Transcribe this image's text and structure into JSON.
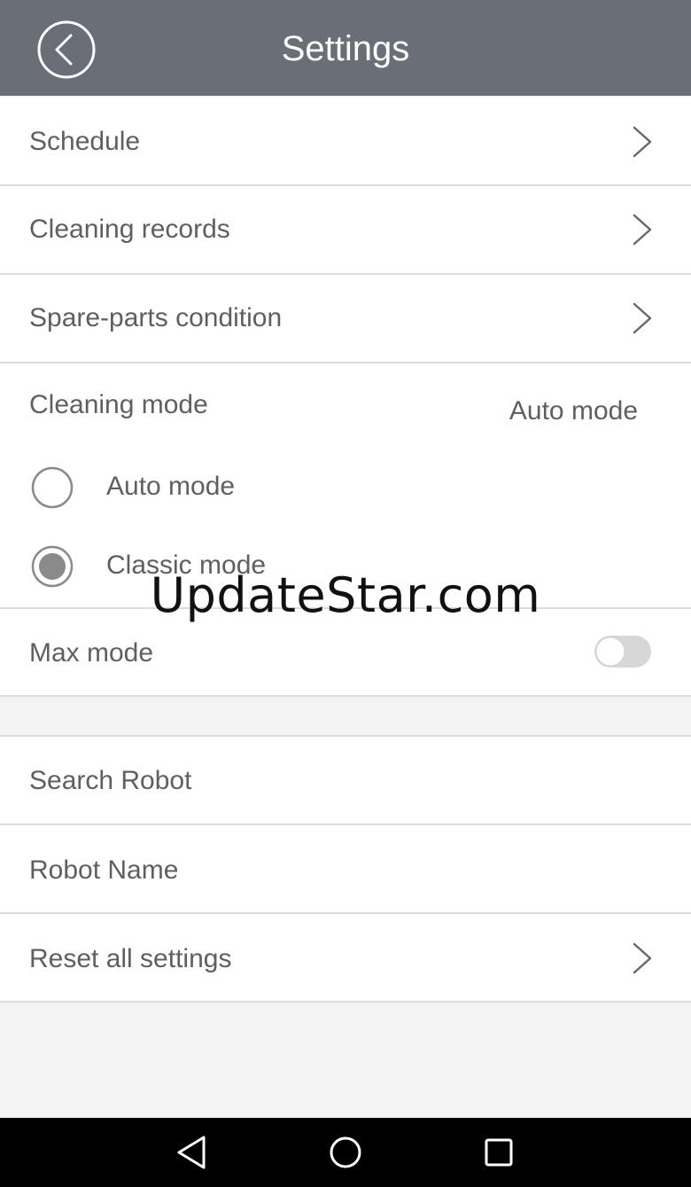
{
  "header": {
    "title": "Settings",
    "back_icon": "back-circle-icon"
  },
  "menu": {
    "schedule": "Schedule",
    "cleaning_records": "Cleaning records",
    "spare_parts": "Spare-parts condition"
  },
  "cleaning_mode": {
    "label": "Cleaning mode",
    "current_value": "Auto mode",
    "options": [
      {
        "label": "Auto mode",
        "selected": false
      },
      {
        "label": "Classic mode",
        "selected": true
      }
    ]
  },
  "max_mode": {
    "label": "Max mode",
    "enabled": false
  },
  "robot": {
    "search": "Search Robot",
    "name": "Robot Name",
    "reset": "Reset all settings"
  },
  "watermark": "UpdateStar.com",
  "colors": {
    "header": "#6a6f77",
    "text": "#5f5f5f",
    "divider": "#dcdcdc"
  },
  "navbar": {
    "icons": [
      "back-triangle-icon",
      "home-circle-icon",
      "recents-square-icon"
    ]
  }
}
